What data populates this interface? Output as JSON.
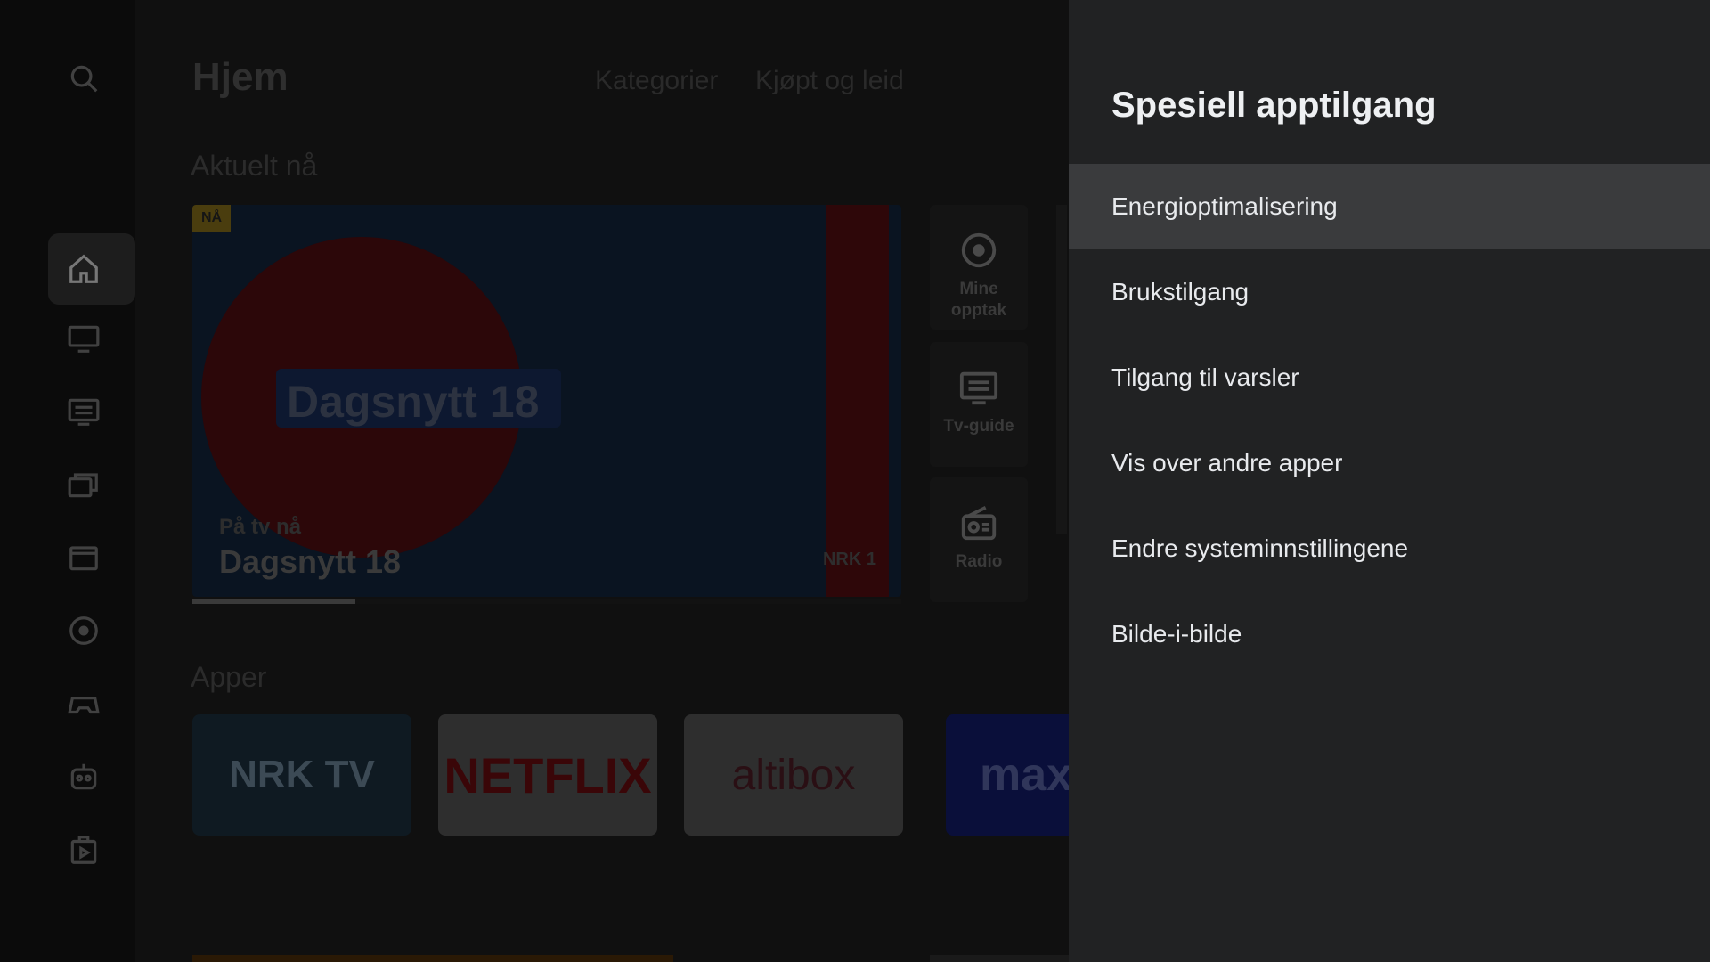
{
  "home": {
    "title": "Hjem",
    "nav": [
      "Kategorier",
      "Kjøpt og leid"
    ],
    "sections": {
      "current": "Aktuelt nå",
      "apps": "Apper"
    },
    "hero": {
      "badge": "NÅ",
      "channel_title": "Dagsnytt 18",
      "subtitle": "På tv nå",
      "program": "Dagsnytt 18",
      "channel_logo": "NRK 1",
      "progress": 0.23
    },
    "side_tiles": [
      {
        "label": "Mine opptak",
        "icon": "record-icon"
      },
      {
        "label": "Tv-guide",
        "icon": "tv-guide-icon"
      },
      {
        "label": "Radio",
        "icon": "radio-icon"
      }
    ],
    "apps": [
      {
        "label": "NRK TV",
        "bg": "#0f1a22",
        "color": "#3c4a55"
      },
      {
        "label": "NETFLIX",
        "bg": "#2e2e2e",
        "color": "#3a0608"
      },
      {
        "label": "altibox",
        "bg": "#2e2e2e",
        "color": "#2a0f14"
      },
      {
        "label": "max",
        "bg": "#0a0f3a",
        "color": "#30365a"
      }
    ],
    "rail_icons": [
      "search-icon",
      "home-icon",
      "tv-icon",
      "tv-guide-icon",
      "library-icon",
      "movies-icon",
      "record-icon",
      "games-icon",
      "kids-icon",
      "apps-icon"
    ]
  },
  "panel": {
    "title": "Spesiell apptilgang",
    "items": [
      "Energioptimalisering",
      "Brukstilgang",
      "Tilgang til varsler",
      "Vis over andre apper",
      "Endre systeminnstillingene",
      "Bilde-i-bilde"
    ],
    "focused_index": 0
  }
}
